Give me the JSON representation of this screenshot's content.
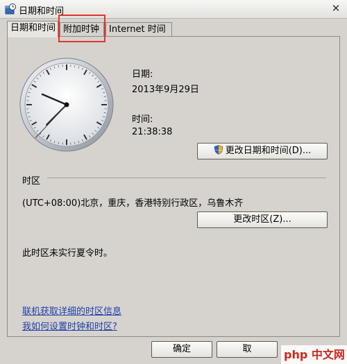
{
  "window": {
    "title": "日期和时间"
  },
  "tabs": [
    {
      "label": "日期和时间"
    },
    {
      "label": "附加时钟"
    },
    {
      "label": "Internet 时间"
    }
  ],
  "datetime": {
    "date_label": "日期:",
    "date_value": "2013年9月29日",
    "time_label": "时间:",
    "time_value": "21:38:38",
    "change_datetime_button": "更改日期和时间(D)..."
  },
  "timezone": {
    "section_label": "时区",
    "value": "(UTC+08:00)北京，重庆，香港特别行政区，乌鲁木齐",
    "change_button": "更改时区(Z)...",
    "dst_note": "此时区未实行夏令时。"
  },
  "links": {
    "get_more_info": "联机获取详细的时区信息",
    "how_to_set": "我如何设置时钟和时区?"
  },
  "footer": {
    "ok_label": "确定",
    "cancel_label": "取"
  },
  "watermark": {
    "text": "php 中文网"
  },
  "icons": {
    "app": "date-time-app-icon",
    "close": "close-icon",
    "shield": "uac-shield-icon"
  },
  "colors": {
    "highlight": "#e0342c",
    "link": "#1f3fa8"
  }
}
